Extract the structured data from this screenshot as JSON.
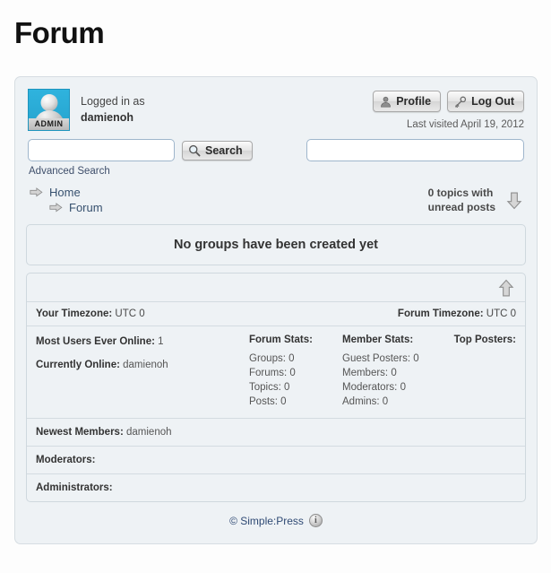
{
  "page": {
    "title": "Forum"
  },
  "user": {
    "avatar_badge": "ADMIN",
    "logged_in_label": "Logged in as",
    "username": "damienoh",
    "last_visited": "Last visited April 19, 2012"
  },
  "buttons": {
    "profile": "Profile",
    "logout": "Log Out",
    "search": "Search"
  },
  "search": {
    "value": "",
    "placeholder": "",
    "advanced_label": "Advanced Search",
    "right_value": "",
    "right_placeholder": ""
  },
  "breadcrumb": {
    "items": [
      {
        "label": "Home"
      },
      {
        "label": "Forum"
      }
    ]
  },
  "unread": {
    "line1": "0 topics with",
    "line2": "unread posts"
  },
  "groups": {
    "empty_message": "No groups have been created yet"
  },
  "timezone": {
    "your_label": "Your Timezone:",
    "your_value": "UTC 0",
    "forum_label": "Forum Timezone:",
    "forum_value": "UTC 0"
  },
  "stats": {
    "most_users_label": "Most Users Ever Online:",
    "most_users_value": "1",
    "currently_online_label": "Currently Online:",
    "currently_online_value": "damienoh",
    "forum_stats": {
      "title": "Forum Stats:",
      "rows": [
        {
          "label": "Groups:",
          "value": "0"
        },
        {
          "label": "Forums:",
          "value": "0"
        },
        {
          "label": "Topics:",
          "value": "0"
        },
        {
          "label": "Posts:",
          "value": "0"
        }
      ]
    },
    "member_stats": {
      "title": "Member Stats:",
      "rows": [
        {
          "label": "Guest Posters:",
          "value": "0"
        },
        {
          "label": "Members:",
          "value": "0"
        },
        {
          "label": "Moderators:",
          "value": "0"
        },
        {
          "label": "Admins:",
          "value": "0"
        }
      ]
    },
    "top_posters": {
      "title": "Top Posters:"
    },
    "newest_members_label": "Newest Members:",
    "newest_members_value": "damienoh",
    "moderators_label": "Moderators:",
    "moderators_value": "",
    "administrators_label": "Administrators:",
    "administrators_value": ""
  },
  "footer": {
    "copyright": "© Simple:Press",
    "info_glyph": "i"
  },
  "colors": {
    "avatar_bg": "#29abd6",
    "page_bg": "#fdfdfd",
    "card_bg": "#eef2f5",
    "link": "#36506e"
  }
}
